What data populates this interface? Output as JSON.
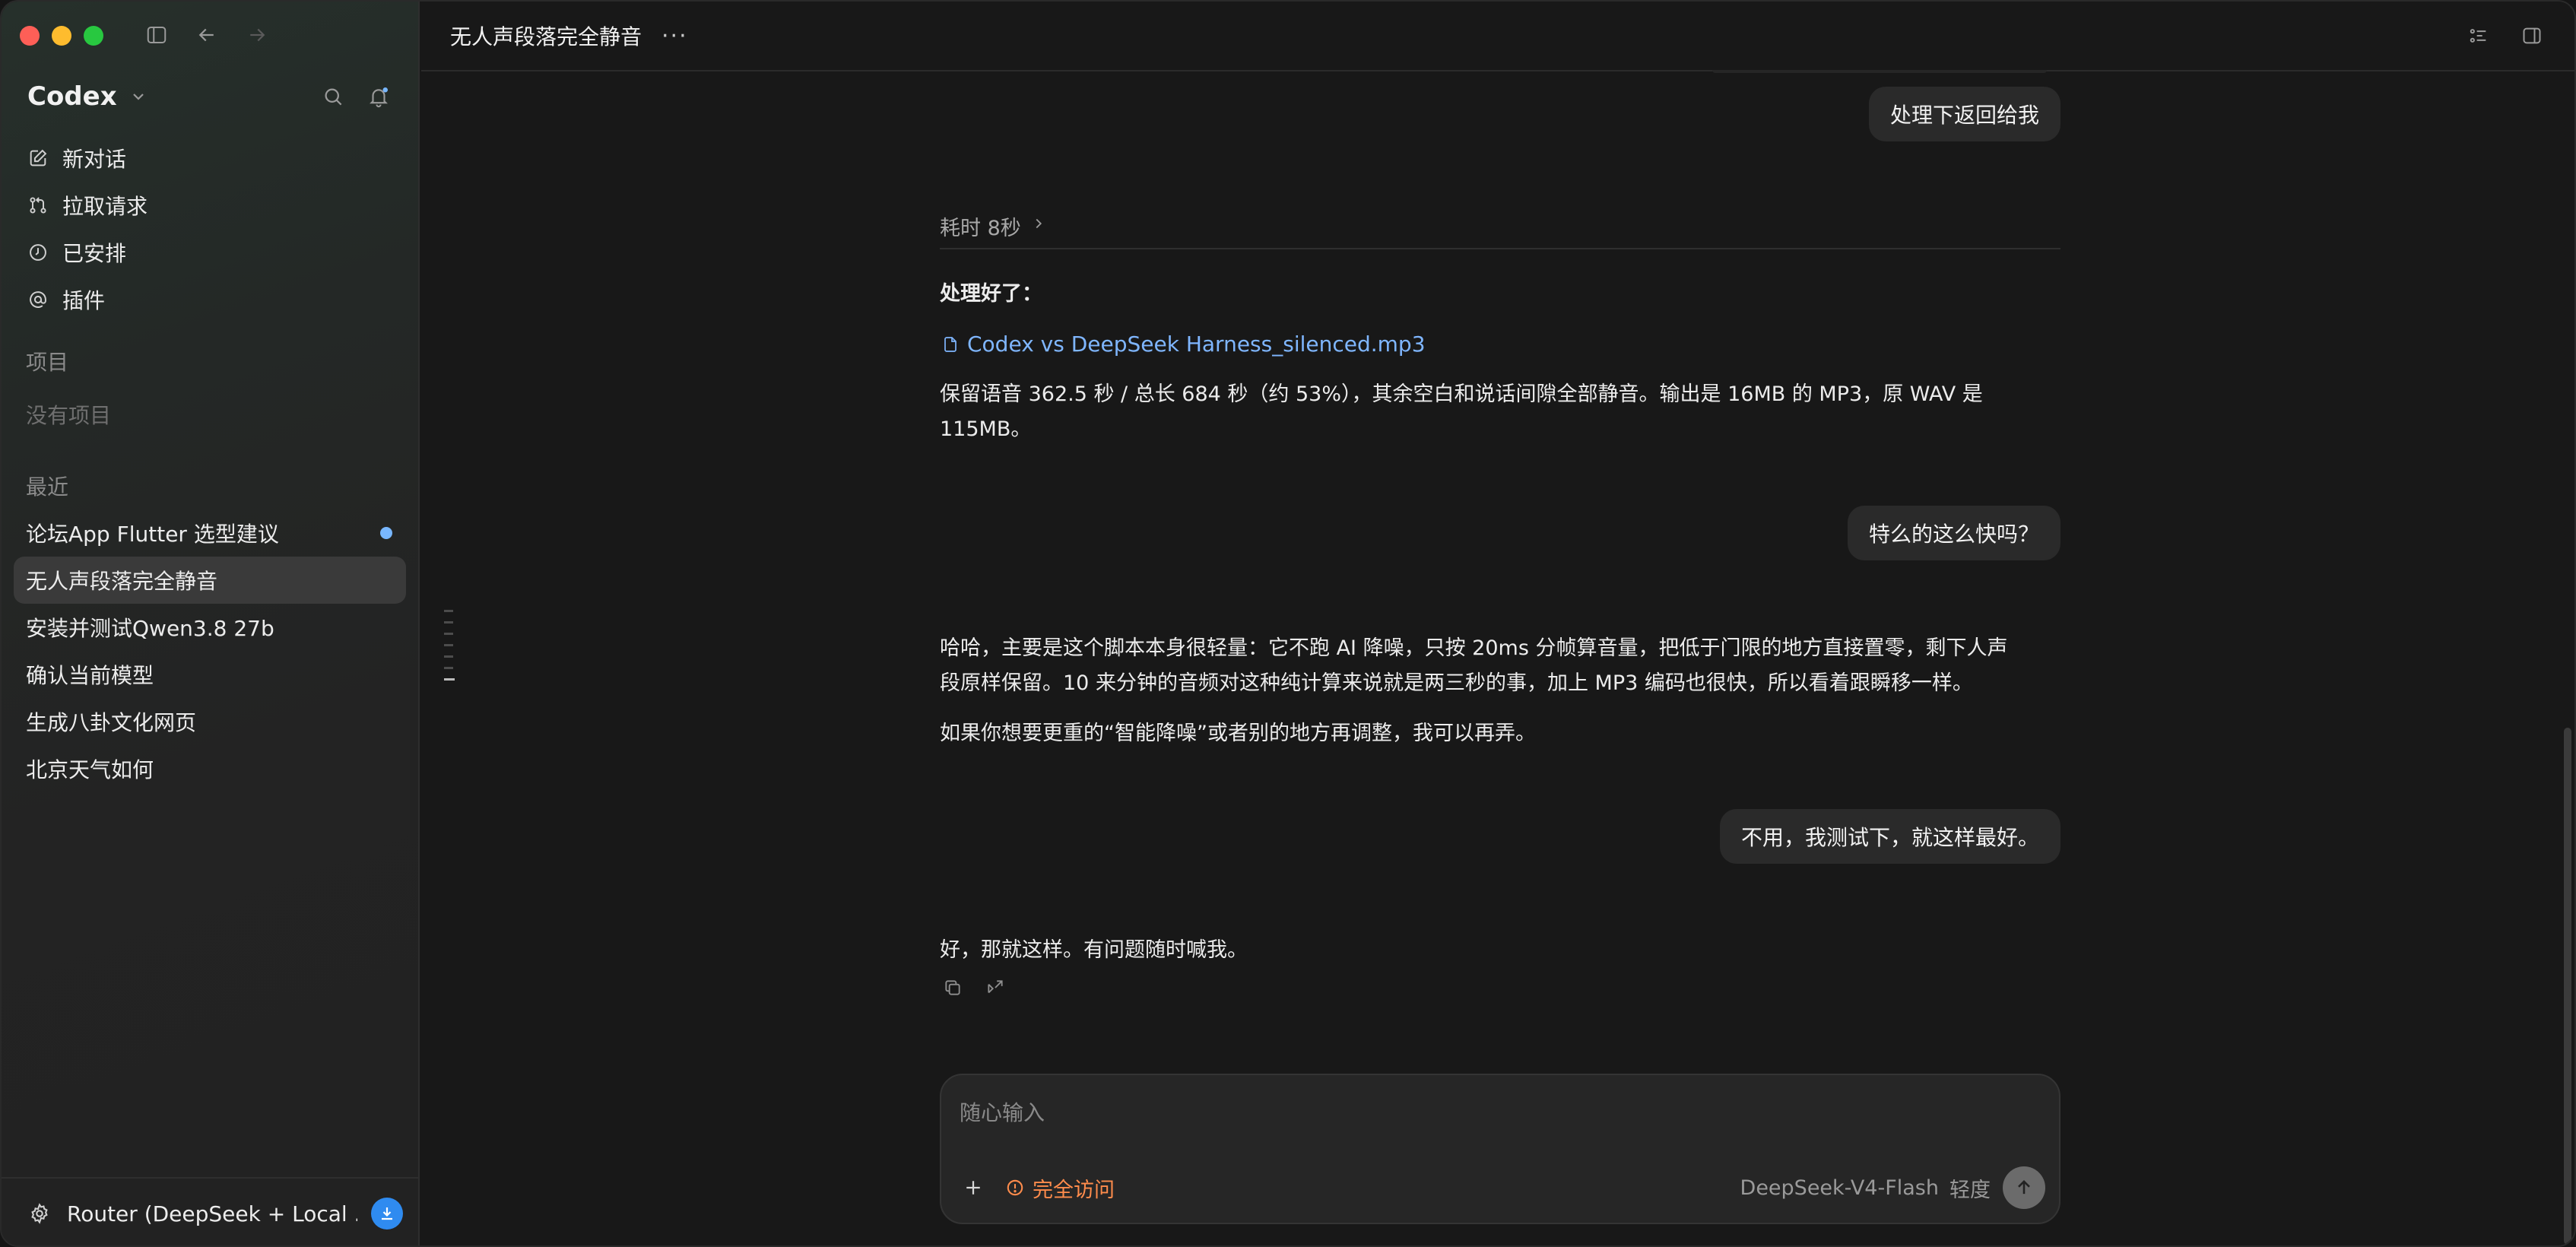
{
  "sidebar": {
    "brand": "Codex",
    "nav": [
      {
        "label": "新对话",
        "icon": "edit-icon"
      },
      {
        "label": "拉取请求",
        "icon": "pull-request-icon"
      },
      {
        "label": "已安排",
        "icon": "clock-icon"
      },
      {
        "label": "插件",
        "icon": "at-icon"
      }
    ],
    "projects_label": "项目",
    "no_projects": "没有项目",
    "recent_label": "最近",
    "recent": [
      {
        "label": "论坛App Flutter 选型建议",
        "unread": true
      },
      {
        "label": "无人声段落完全静音",
        "active": true
      },
      {
        "label": "安装并测试Qwen3.8 27b"
      },
      {
        "label": "确认当前模型"
      },
      {
        "label": "生成八卦文化网页"
      },
      {
        "label": "北京天气如何"
      }
    ],
    "footer_label": "Router (DeepSeek + Local ..."
  },
  "topbar": {
    "title": "无人声段落完全静音",
    "more": "···"
  },
  "chat": {
    "user_msg_1": "处理下返回给我",
    "duration": "耗时 8秒",
    "reply_1_heading": "处理好了：",
    "reply_1_file": "Codex vs DeepSeek Harness_silenced.mp3",
    "reply_1_body_line1": "保留语音 362.5 秒 / 总长 684 秒（约 53%），其余空白和说话间隙全部静音。输出是 16MB 的 MP3，原 WAV 是",
    "reply_1_body_line2": "115MB。",
    "user_msg_2": "特么的这么快吗？",
    "reply_2_line1": "哈哈，主要是这个脚本本身很轻量：它不跑 AI 降噪，只按 20ms 分帧算音量，把低于门限的地方直接置零，剩下人声",
    "reply_2_line2": "段原样保留。10 来分钟的音频对这种纯计算来说就是两三秒的事，加上 MP3 编码也很快，所以看着跟瞬移一样。",
    "reply_2_line3": "如果你想要更重的“智能降噪”或者别的地方再调整，我可以再弄。",
    "user_msg_3": "不用，我测试下，就这样最好。",
    "reply_3": "好，那就这样。有问题随时喊我。"
  },
  "composer": {
    "placeholder": "随心输入",
    "access_label": "完全访问",
    "model": "DeepSeek-V4-Flash",
    "effort": "轻度"
  },
  "colors": {
    "accent_blue": "#2f8bf0",
    "link_blue": "#7fb6ff",
    "warning_orange": "#ff8c4c"
  }
}
